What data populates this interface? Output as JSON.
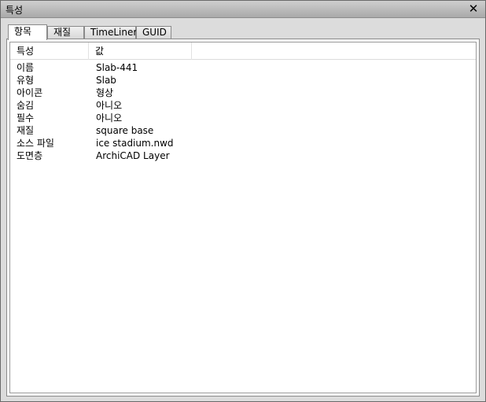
{
  "window": {
    "title": "특성",
    "close_symbol": "✕"
  },
  "tabs": [
    {
      "label": "항목",
      "active": true
    },
    {
      "label": "재질",
      "active": false
    },
    {
      "label": "TimeLiner",
      "active": false
    },
    {
      "label": "GUID",
      "active": false
    }
  ],
  "table": {
    "columns": [
      "특성",
      "값",
      ""
    ],
    "rows": [
      {
        "key": "이름",
        "value": "Slab-441"
      },
      {
        "key": "유형",
        "value": "Slab"
      },
      {
        "key": "아이콘",
        "value": "형상"
      },
      {
        "key": "숨김",
        "value": "아니오"
      },
      {
        "key": "필수",
        "value": "아니오"
      },
      {
        "key": "재질",
        "value": "square base"
      },
      {
        "key": "소스 파일",
        "value": "ice stadium.nwd"
      },
      {
        "key": "도면층",
        "value": "ArchiCAD Layer"
      }
    ]
  }
}
